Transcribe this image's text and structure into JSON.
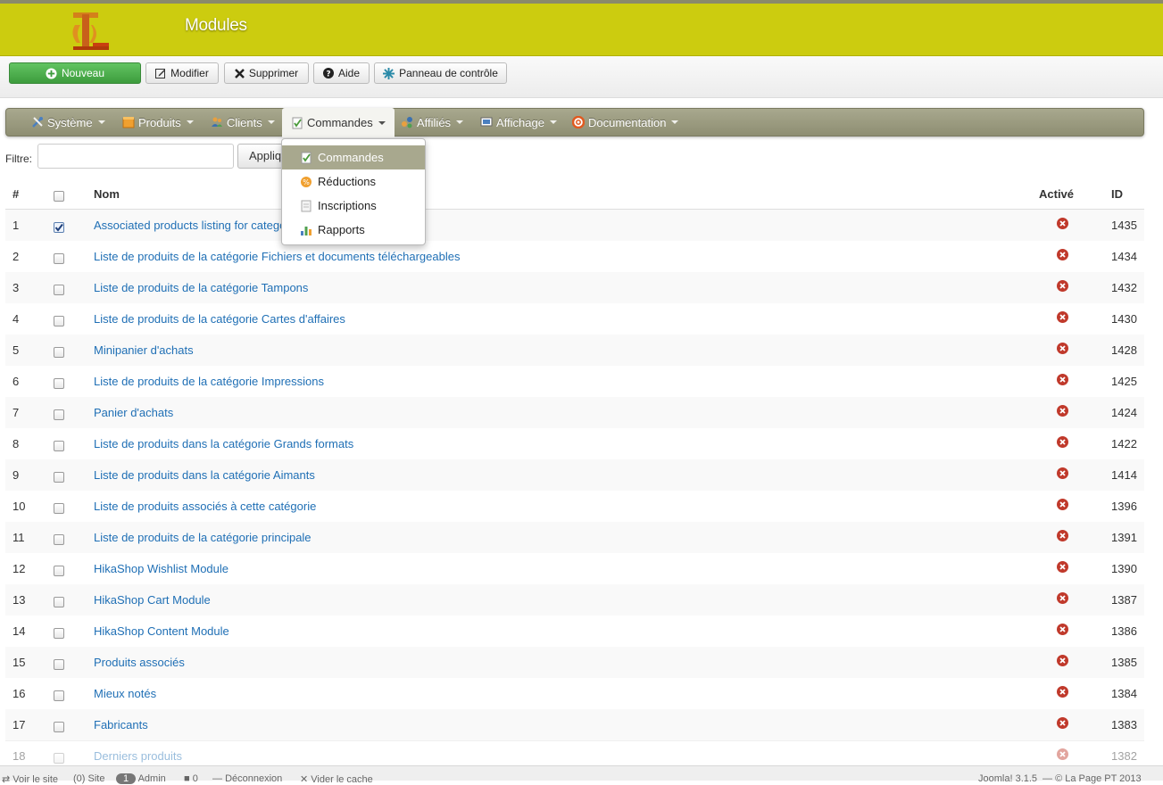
{
  "header": {
    "title": "Modules"
  },
  "toolbar": {
    "new_label": "Nouveau",
    "edit_label": "Modifier",
    "delete_label": "Supprimer",
    "help_label": "Aide",
    "panel_label": "Panneau de contrôle"
  },
  "nav": {
    "items": [
      {
        "label": "Système"
      },
      {
        "label": "Produits"
      },
      {
        "label": "Clients"
      },
      {
        "label": "Commandes"
      },
      {
        "label": "Affiliés"
      },
      {
        "label": "Affichage"
      },
      {
        "label": "Documentation"
      }
    ],
    "dropdown": [
      {
        "label": "Commandes"
      },
      {
        "label": "Réductions"
      },
      {
        "label": "Inscriptions"
      },
      {
        "label": "Rapports"
      }
    ]
  },
  "filter": {
    "label": "Filtre:",
    "value": "",
    "apply_label": "Appliquer"
  },
  "table": {
    "headers": {
      "num": "#",
      "name": "Nom",
      "active": "Activé",
      "id": "ID"
    },
    "rows": [
      {
        "num": "1",
        "name": "Associated products listing for category",
        "id": "1435",
        "checked": true
      },
      {
        "num": "2",
        "name": "Liste de produits de la catégorie Fichiers et documents téléchargeables",
        "id": "1434"
      },
      {
        "num": "3",
        "name": "Liste de produits de la catégorie Tampons",
        "id": "1432"
      },
      {
        "num": "4",
        "name": "Liste de produits de la catégorie Cartes d'affaires",
        "id": "1430"
      },
      {
        "num": "5",
        "name": "Minipanier d'achats",
        "id": "1428"
      },
      {
        "num": "6",
        "name": "Liste de produits de la catégorie Impressions",
        "id": "1425"
      },
      {
        "num": "7",
        "name": "Panier d'achats",
        "id": "1424"
      },
      {
        "num": "8",
        "name": "Liste de produits dans la catégorie Grands formats",
        "id": "1422"
      },
      {
        "num": "9",
        "name": "Liste de produits dans la catégorie Aimants",
        "id": "1414"
      },
      {
        "num": "10",
        "name": "Liste de produits associés à cette catégorie",
        "id": "1396"
      },
      {
        "num": "11",
        "name": "Liste de produits de la catégorie principale",
        "id": "1391"
      },
      {
        "num": "12",
        "name": "HikaShop Wishlist Module",
        "id": "1390"
      },
      {
        "num": "13",
        "name": "HikaShop Cart Module",
        "id": "1387"
      },
      {
        "num": "14",
        "name": "HikaShop Content Module",
        "id": "1386"
      },
      {
        "num": "15",
        "name": "Produits associés",
        "id": "1385"
      },
      {
        "num": "16",
        "name": "Mieux notés",
        "id": "1384"
      },
      {
        "num": "17",
        "name": "Fabricants",
        "id": "1383"
      },
      {
        "num": "18",
        "name": "Derniers produits",
        "id": "1382"
      }
    ]
  },
  "footer": {
    "view_site": "Voir le site",
    "site_count": "(0) Site",
    "admin_count": "1",
    "admin_label": "Admin",
    "messages": "0",
    "logout": "Déconnexion",
    "clear_cache": "Vider le cache",
    "version": "Joomla! 3.1.5",
    "copyright": "© La Page PT 2013"
  },
  "colors": {
    "header": "#cccc0f",
    "navbar": "#9e9e84",
    "link": "#1f6fb5",
    "status_off": "#c0392b",
    "new_button": "#4cae4c"
  }
}
